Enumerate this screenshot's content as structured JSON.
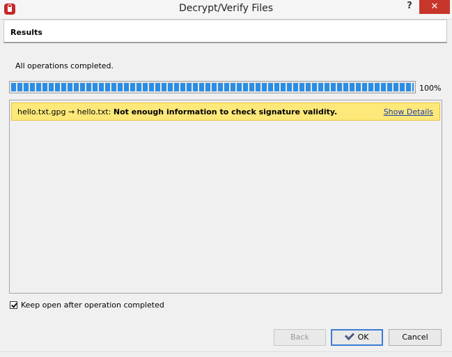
{
  "window": {
    "title": "Decrypt/Verify Files",
    "help_label": "?",
    "close_label": "✕"
  },
  "header": {
    "title": "Results"
  },
  "status": {
    "text": "All operations completed.",
    "progress_fraction": 1.0,
    "progress_label": "100%"
  },
  "results": [
    {
      "files": "hello.txt.gpg → hello.txt: ",
      "message": "Not enough information to check signature validity.",
      "link_label": "Show Details",
      "color": "#fde87a"
    }
  ],
  "options": {
    "keep_open_label": "Keep open after operation completed",
    "keep_open_checked": true
  },
  "buttons": {
    "back": "Back",
    "ok": "OK",
    "cancel": "Cancel"
  },
  "colors": {
    "accent": "#2b8de4",
    "close": "#c7362b",
    "warning": "#fde87a"
  }
}
